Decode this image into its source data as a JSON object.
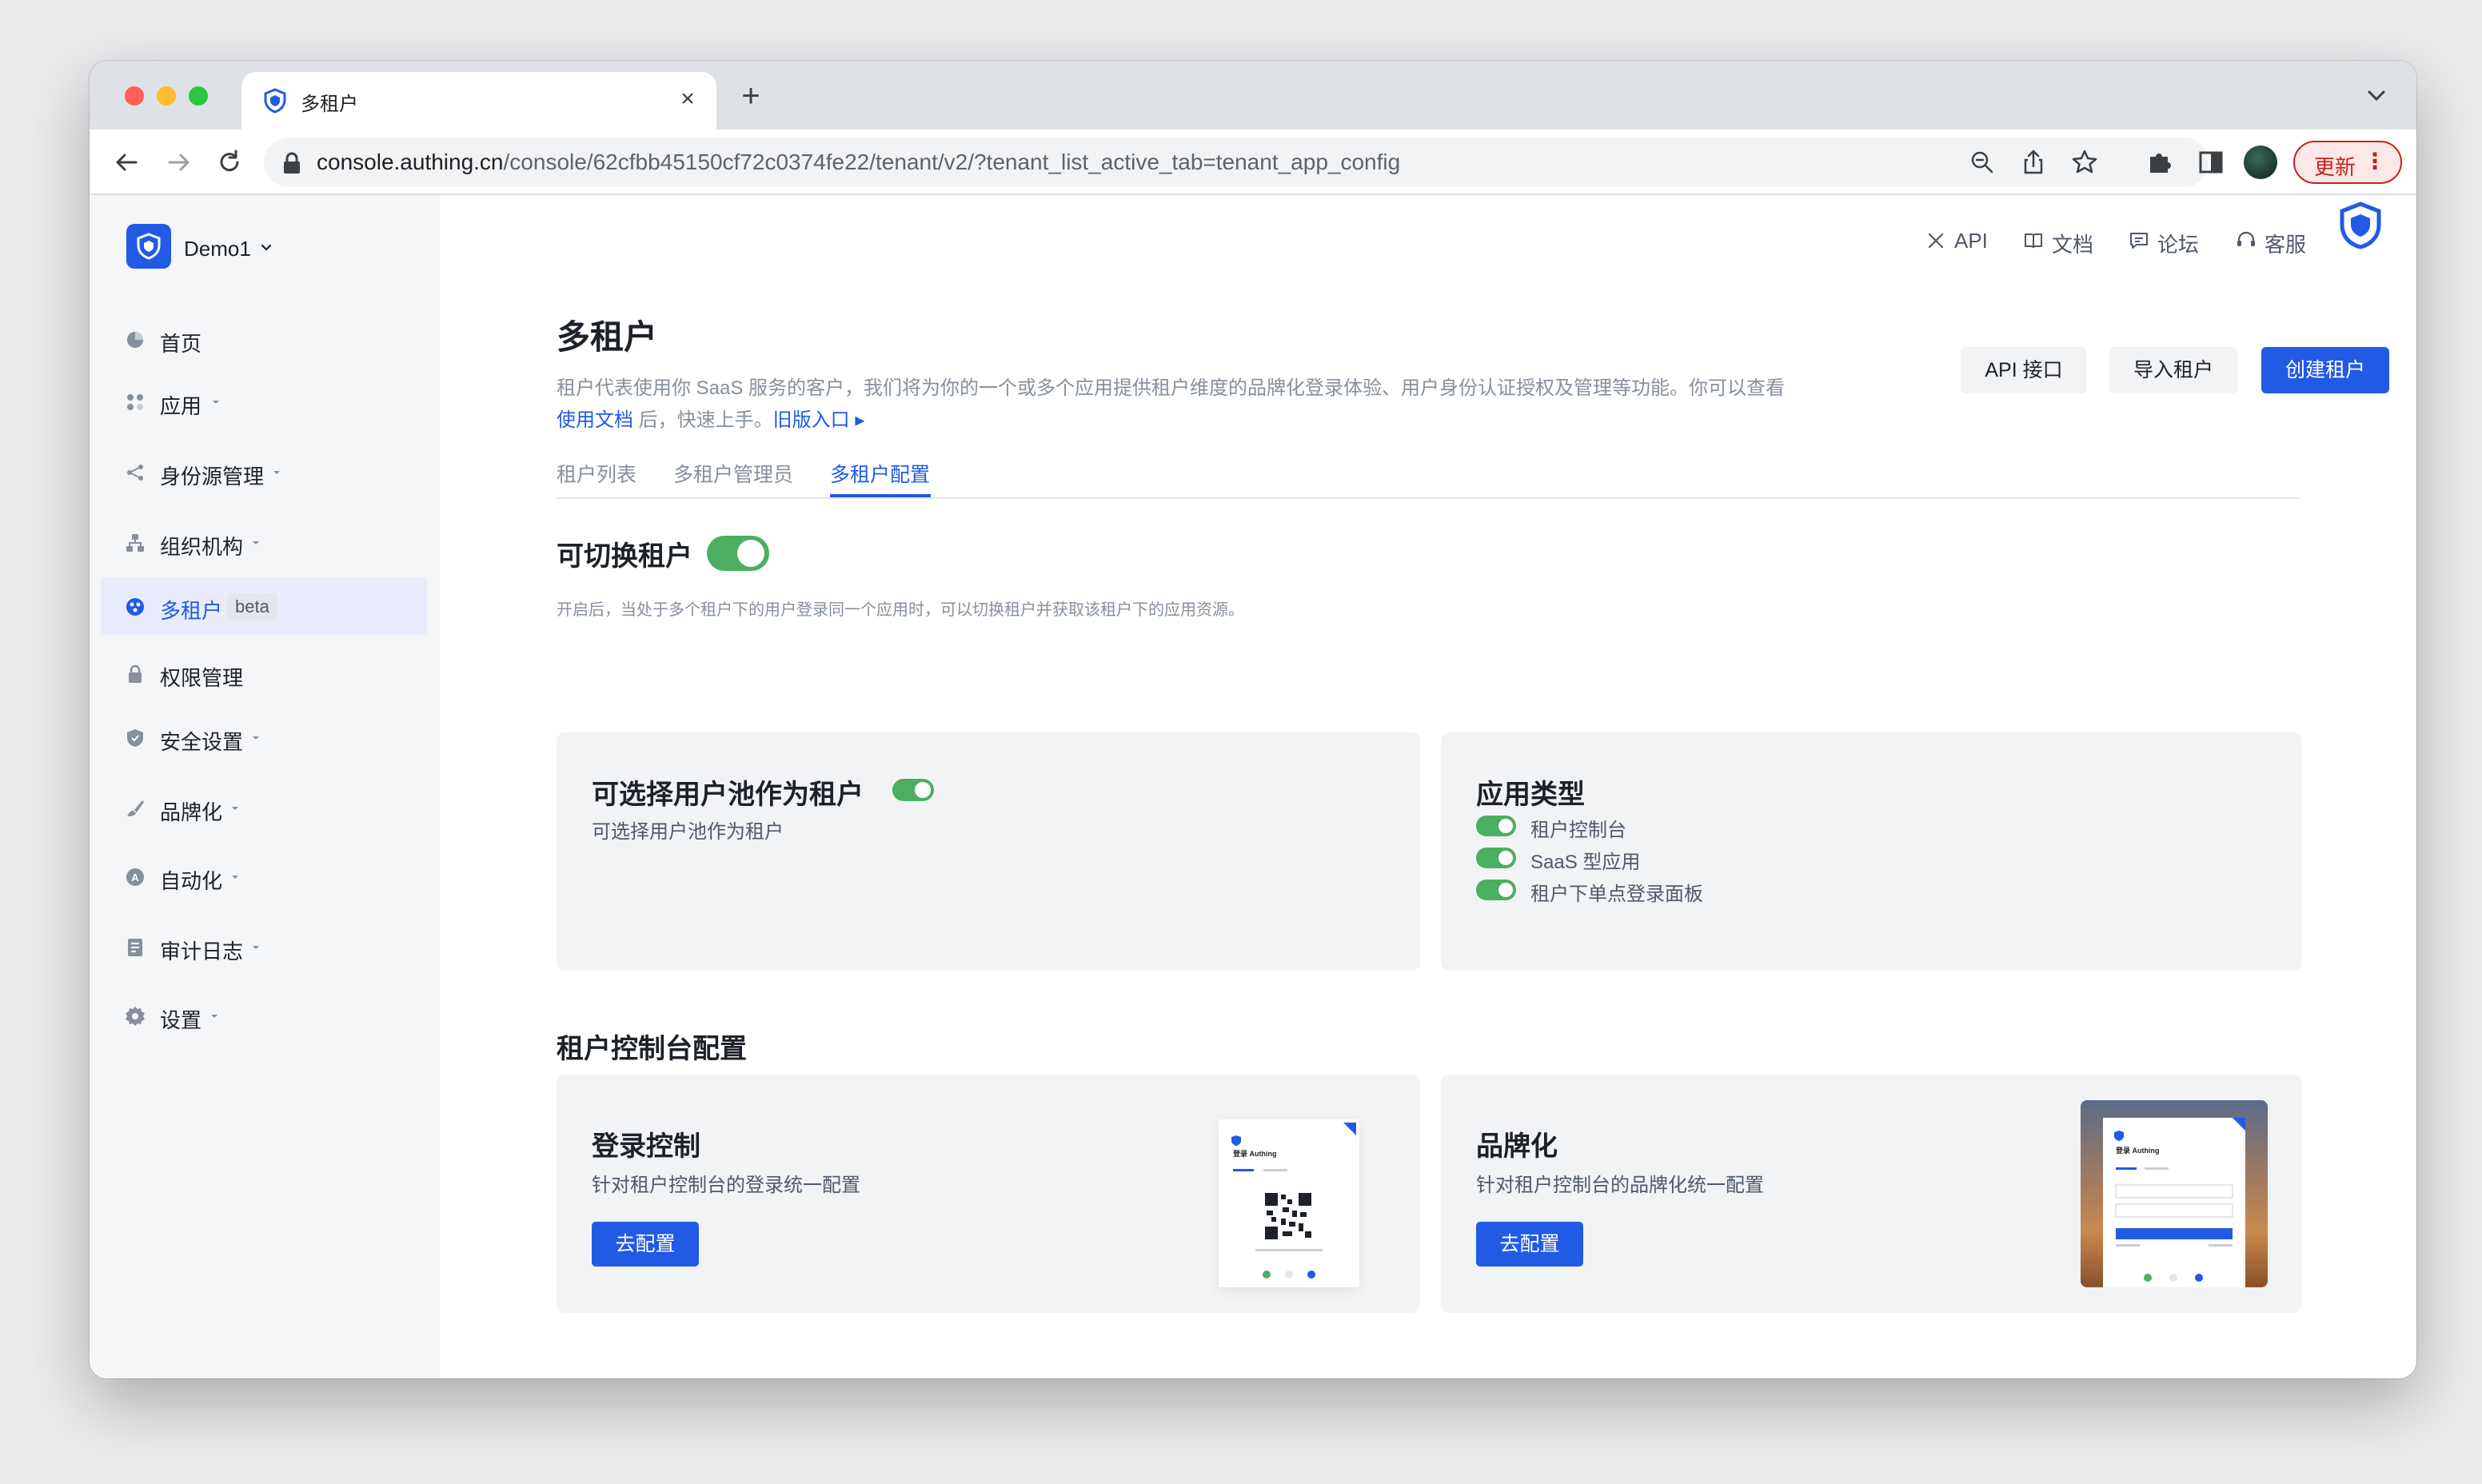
{
  "browser": {
    "tab_title": "多租户",
    "url_host": "console.authing.cn",
    "url_path": "/console/62cfbb45150cf72c0374fe22/tenant/v2/?tenant_list_active_tab=tenant_app_config",
    "update_label": "更新"
  },
  "sidebar": {
    "workspace": "Demo1",
    "items": [
      {
        "label": "首页",
        "icon": "pie-chart-icon",
        "has_caret": false
      },
      {
        "label": "应用",
        "icon": "apps-grid-icon",
        "has_caret": true
      },
      {
        "label": "身份源管理",
        "icon": "share-nodes-icon",
        "has_caret": true
      },
      {
        "label": "组织机构",
        "icon": "org-tree-icon",
        "has_caret": true
      },
      {
        "label": "多租户",
        "icon": "tenant-icon",
        "has_caret": false,
        "active": true,
        "badge": "beta"
      },
      {
        "label": "权限管理",
        "icon": "lock-icon",
        "has_caret": false
      },
      {
        "label": "安全设置",
        "icon": "shield-check-icon",
        "has_caret": true
      },
      {
        "label": "品牌化",
        "icon": "brush-icon",
        "has_caret": true
      },
      {
        "label": "自动化",
        "icon": "automation-icon",
        "has_caret": true
      },
      {
        "label": "审计日志",
        "icon": "log-icon",
        "has_caret": true
      },
      {
        "label": "设置",
        "icon": "gear-icon",
        "has_caret": true
      }
    ]
  },
  "topnav": {
    "api": "API",
    "docs": "文档",
    "forum": "论坛",
    "support": "客服"
  },
  "page": {
    "title": "多租户",
    "desc_main": "租户代表使用你 SaaS 服务的客户，我们将为你的一个或多个应用提供租户维度的品牌化登录体验、用户身份认证授权及管理等功能。你可以查看",
    "desc_link": "使用文档",
    "desc_tail": "后，快速上手。",
    "legacy_link": "旧版入口",
    "buttons": {
      "api": "API 接口",
      "import": "导入租户",
      "create": "创建租户"
    },
    "tabs": [
      "租户列表",
      "多租户管理员",
      "多租户配置"
    ],
    "active_tab": "多租户配置"
  },
  "config": {
    "switchable_title": "可切换租户",
    "switchable_enabled": true,
    "switchable_hint": "开启后，当处于多个租户下的用户登录同一个应用时，可以切换租户并获取该租户下的应用资源。",
    "userpool_card": {
      "title": "可选择用户池作为租户",
      "subtitle": "可选择用户池作为租户",
      "enabled": true
    },
    "app_type_card": {
      "title": "应用类型",
      "options": [
        {
          "label": "租户控制台",
          "enabled": true
        },
        {
          "label": "SaaS 型应用",
          "enabled": true
        },
        {
          "label": "租户下单点登录面板",
          "enabled": true
        }
      ]
    },
    "console_section_title": "租户控制台配置",
    "login_card": {
      "title": "登录控制",
      "subtitle": "针对租户控制台的登录统一配置",
      "button": "去配置",
      "preview_text": "登录 Authing"
    },
    "brand_card": {
      "title": "品牌化",
      "subtitle": "针对租户控制台的品牌化统一配置",
      "button": "去配置",
      "preview_text": "登录 Authing"
    }
  },
  "colors": {
    "primary": "#215ae5",
    "switch_on": "#4cae61",
    "card_bg": "#f2f3f5",
    "sidebar_bg": "#f5f6f8"
  }
}
